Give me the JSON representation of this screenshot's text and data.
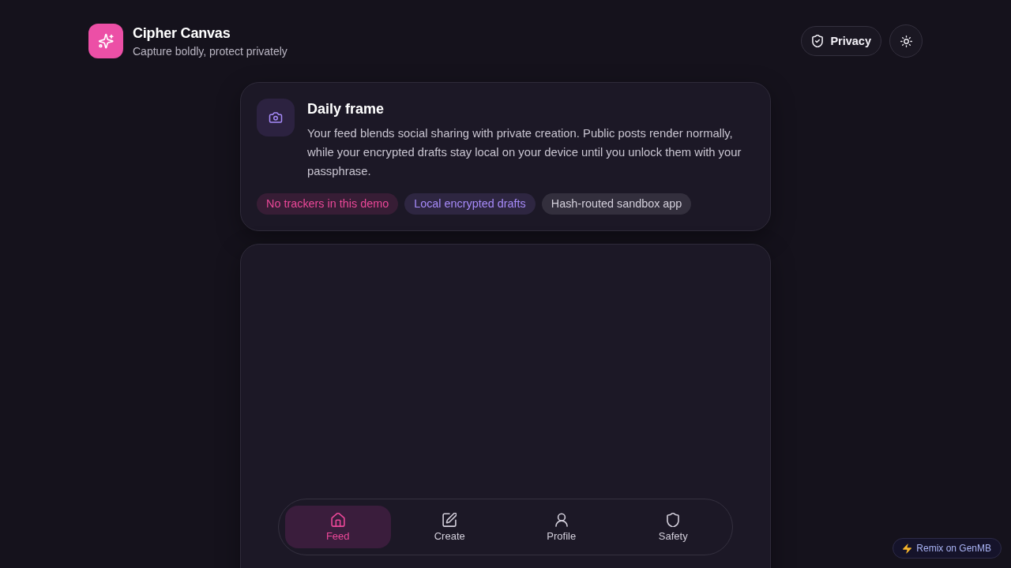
{
  "header": {
    "title": "Cipher Canvas",
    "subtitle": "Capture boldly, protect privately",
    "privacy_button": "Privacy"
  },
  "intro_card": {
    "title": "Daily frame",
    "body": "Your feed blends social sharing with private creation. Public posts render normally, while your encrypted drafts stay local on your device until you unlock them with your passphrase.",
    "tags": [
      {
        "label": "No trackers in this demo",
        "color": "#ec4899"
      },
      {
        "label": "Local encrypted drafts",
        "color": "#a78bfa"
      },
      {
        "label": "Hash-routed sandbox app",
        "color": "#d4d0dc"
      }
    ]
  },
  "bottom_nav": [
    {
      "label": "Feed",
      "selected": true
    },
    {
      "label": "Create",
      "selected": false
    },
    {
      "label": "Profile",
      "selected": false
    },
    {
      "label": "Safety",
      "selected": false
    }
  ],
  "remix_badge": {
    "label": "Remix on GenMB"
  }
}
